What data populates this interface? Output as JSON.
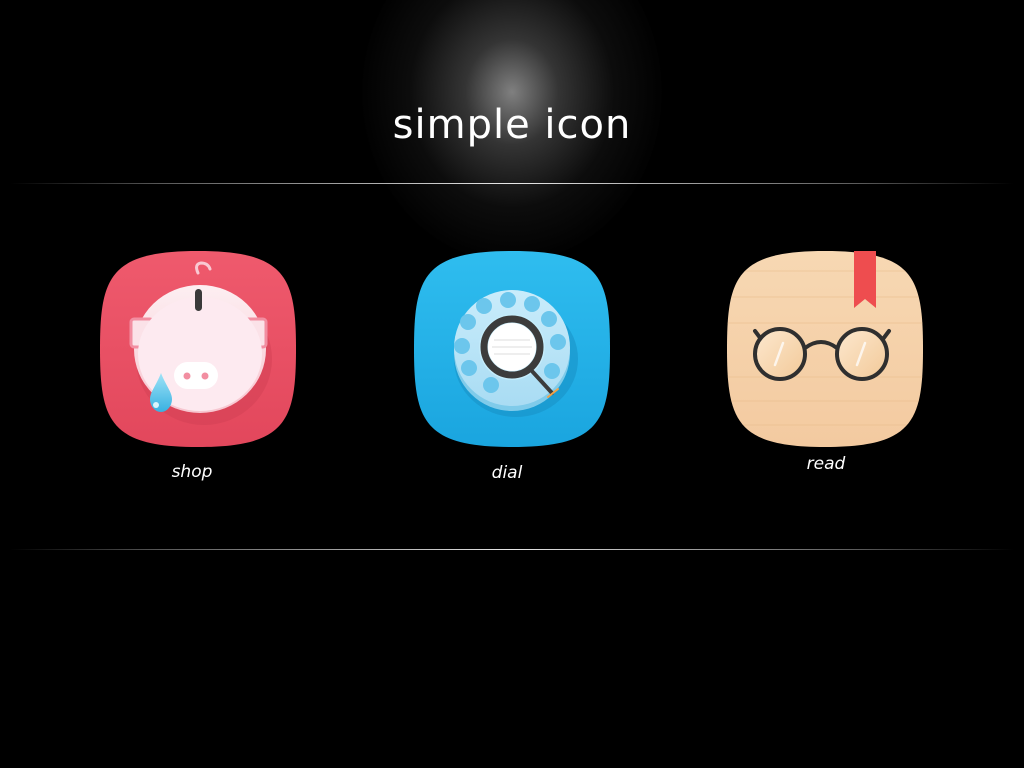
{
  "header": {
    "title": "simple icon"
  },
  "icons": [
    {
      "label": "shop",
      "icon": "piggy-bank-icon",
      "color": "#ea4f63"
    },
    {
      "label": "dial",
      "icon": "rotary-dial-icon",
      "color": "#29b3ea"
    },
    {
      "label": "read",
      "icon": "glasses-bookmark-icon",
      "color": "#f6d3a9"
    }
  ],
  "colors": {
    "background": "#000000",
    "title_text": "#ffffff",
    "bookmark": "#ee4d4f"
  }
}
